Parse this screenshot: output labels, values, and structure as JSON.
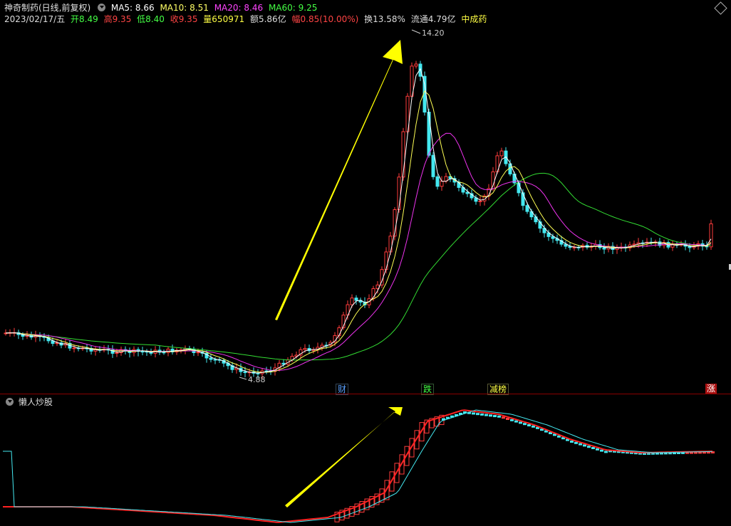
{
  "header": {
    "title": "神奇制药(日线,前复权)",
    "ma": [
      {
        "label": "MA5: 8.66",
        "color": "#ffffff"
      },
      {
        "label": "MA10: 8.51",
        "color": "#ffff66"
      },
      {
        "label": "MA20: 8.46",
        "color": "#ff44ff"
      },
      {
        "label": "MA60: 9.25",
        "color": "#44ff44"
      }
    ],
    "quote": [
      {
        "label": "2023/02/17/五",
        "color": "#dddddd"
      },
      {
        "label": "开8.49",
        "color": "#44ff44"
      },
      {
        "label": "高9.35",
        "color": "#ff4444"
      },
      {
        "label": "低8.40",
        "color": "#44ff44"
      },
      {
        "label": "收9.35",
        "color": "#ff4444"
      },
      {
        "label": "量650971",
        "color": "#ffff44"
      },
      {
        "label": "额5.86亿",
        "color": "#dddddd"
      },
      {
        "label": "幅0.85(10.00%)",
        "color": "#ff4444"
      },
      {
        "label": "换13.58%",
        "color": "#dddddd"
      },
      {
        "label": "流通4.79亿",
        "color": "#dddddd"
      },
      {
        "label": "中成药",
        "color": "#ffff44"
      }
    ]
  },
  "colors": {
    "up": "#ff3b3b",
    "down": "#44e8f0",
    "bg": "#000000"
  },
  "annotations": {
    "high": "14.20",
    "low": "4.88"
  },
  "events": [
    {
      "label": "财",
      "color": "#5aa0ff"
    },
    {
      "label": "跌",
      "color": "#44ff44"
    },
    {
      "label": "减榜",
      "color": "#ffff44"
    },
    {
      "label": "涨",
      "color": "#ffffff"
    }
  ],
  "indicator": {
    "name": "懒人炒股"
  }
}
